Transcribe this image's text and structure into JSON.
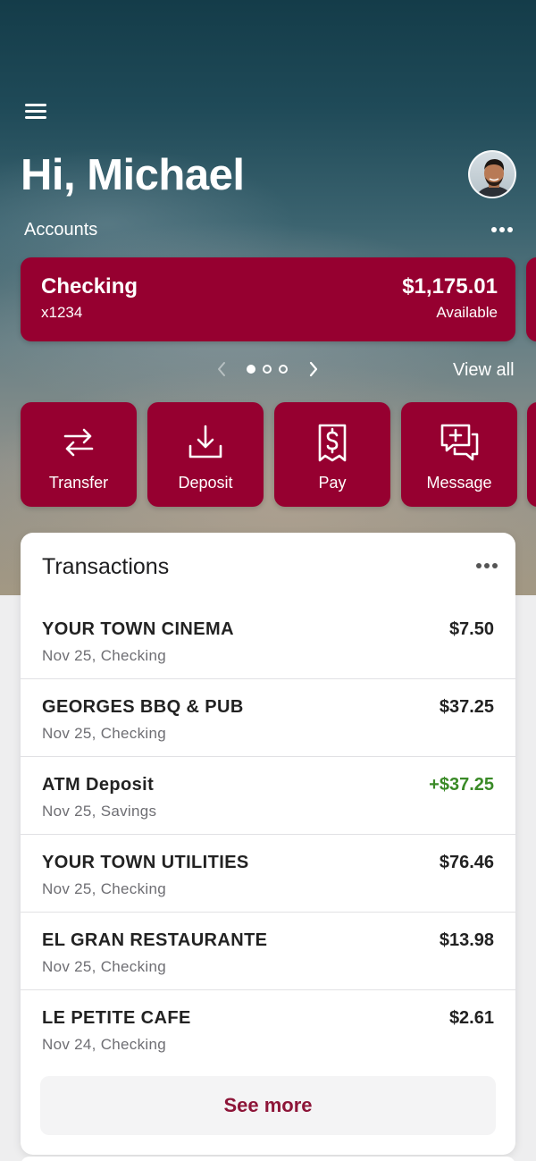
{
  "header": {
    "greeting": "Hi, Michael",
    "accounts_label": "Accounts",
    "menu_icon": "hamburger-menu-icon",
    "more_icon": "more-horizontal-icon"
  },
  "account_card": {
    "name": "Checking",
    "number": "x1234",
    "balance": "$1,175.01",
    "balance_label": "Available"
  },
  "carousel": {
    "page": 1,
    "pages": 3,
    "view_all": "View all"
  },
  "actions": [
    {
      "label": "Transfer",
      "icon": "transfer-arrows-icon"
    },
    {
      "label": "Deposit",
      "icon": "deposit-download-icon"
    },
    {
      "label": "Pay",
      "icon": "bill-dollar-icon"
    },
    {
      "label": "Message",
      "icon": "message-add-icon"
    }
  ],
  "transactions": {
    "title": "Transactions",
    "items": [
      {
        "name": "YOUR TOWN CINEMA",
        "detail": "Nov 25, Checking",
        "amount": "$7.50"
      },
      {
        "name": "GEORGES BBQ & PUB",
        "detail": "Nov 25, Checking",
        "amount": "$37.25"
      },
      {
        "name": "ATM Deposit",
        "detail": "Nov 25, Savings",
        "amount": "+$37.25"
      },
      {
        "name": "YOUR TOWN UTILITIES",
        "detail": "Nov 25, Checking",
        "amount": "$76.46"
      },
      {
        "name": "EL GRAN RESTAURANTE",
        "detail": "Nov 25, Checking",
        "amount": "$13.98"
      },
      {
        "name": "LE PETITE CAFE",
        "detail": "Nov 24, Checking",
        "amount": "$2.61"
      }
    ],
    "see_more": "See more"
  },
  "colors": {
    "brand": "#960030",
    "credit": "#3a8a27",
    "link": "#8d1538"
  }
}
